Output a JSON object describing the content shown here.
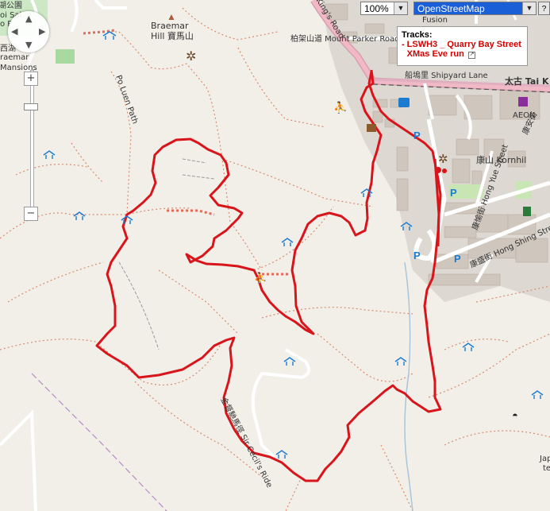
{
  "map": {
    "labels": {
      "braemar_hill_en": "Braemar",
      "braemar_hill_zh": "Hill 寶馬山",
      "po_luen_path": "Po Luen Path",
      "braemar_mansions_1": "raemar",
      "braemar_mansions_2": "Mansions",
      "top_left_zh": "湖公園",
      "top_left_2": "oi Sai",
      "top_left_3": "o P",
      "west_lake": "西湖",
      "kings_road": "King's Road",
      "mount_parker_road": "柏架山道 Mount Parker Road",
      "shipyard_lane": "船塢里 Shipyard Lane",
      "fusion": "Fusion",
      "tai_koo": "太古 Tai K",
      "aeon": "AEON",
      "aeon_zh": "康安街",
      "kornhill": "康山 Kornhil",
      "hong_yue_street": "康愉街 Hong Yue Street",
      "hong_shing_street": "康盛街 Hong Shing Street",
      "sir_cecils_ride": "金督馳馬徑 Sir Cecil's Ride",
      "japan": "Jap",
      "japan_2": "te"
    }
  },
  "controls": {
    "zoom_in": "+",
    "zoom_out": "−",
    "scale_select": "100%",
    "layer_select": "OpenStreetMap"
  },
  "tracks_panel": {
    "header": "Tracks:",
    "bullet": "-",
    "track_name": "LSWH3 _ Quarry Bay Street XMas Eve run",
    "link_icon": "external-link-icon"
  },
  "colors": {
    "track": "#d8151b",
    "path_dotted": "#d98c6f",
    "road_pink": "#e8a0b4",
    "accent_blue": "#1a7bd0"
  }
}
